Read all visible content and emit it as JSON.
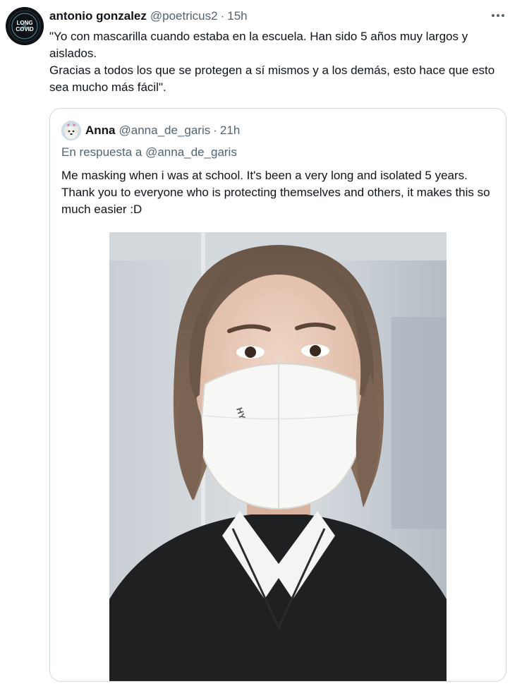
{
  "tweet": {
    "display_name": "antonio gonzalez",
    "handle": "@poetricus2",
    "separator": "·",
    "time": "15h",
    "avatar_badge_line1": "LONG",
    "avatar_badge_line2": "COVID",
    "text_line1": "\"Yo con mascarilla cuando estaba en la escuela. Han sido 5 años muy largos y aislados.",
    "text_line2": "Gracias a todos los que se protegen a sí mismos y a los demás, esto hace que esto sea mucho más fácil\"."
  },
  "quoted": {
    "display_name": "Anna",
    "handle": "@anna_de_garis",
    "separator": "·",
    "time": "21h",
    "reply_prefix": "En respuesta a",
    "reply_handle": "@anna_de_garis",
    "text": "Me masking when i was at school. It's been a very long and isolated 5 years. Thank you to everyone who is protecting themselves and others, it makes this so much easier :D"
  },
  "colors": {
    "primary_text": "#0f1419",
    "secondary_text": "#536471",
    "border": "#cfd9de",
    "background": "#ffffff"
  },
  "icons": {
    "more": "more-horizontal-icon",
    "avatar_badge": "long-covid-badge"
  }
}
